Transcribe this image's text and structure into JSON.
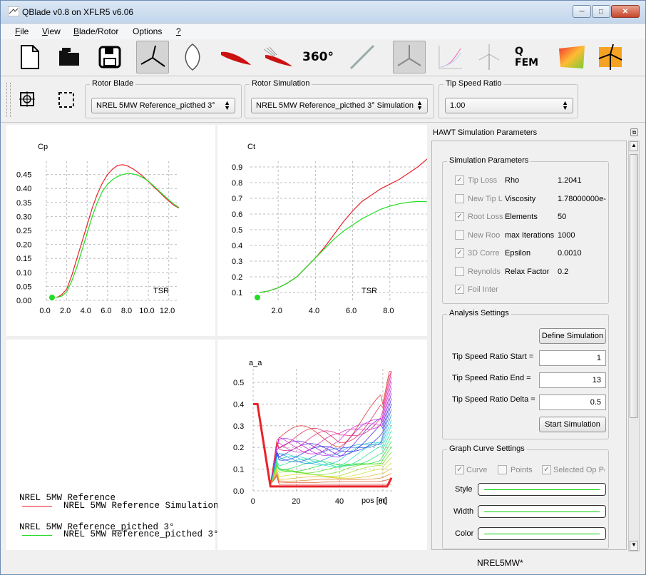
{
  "window": {
    "title": "QBlade v0.8 on XFLR5 v6.06"
  },
  "menu": [
    {
      "label": "File",
      "u": "F",
      "rest": "ile"
    },
    {
      "label": "View",
      "u": "V",
      "rest": "iew"
    },
    {
      "label": "Blade/Rotor",
      "u": "B",
      "rest": "lade/Rotor"
    },
    {
      "label": "Options",
      "u": "",
      "rest": "Options"
    },
    {
      "label": "?",
      "u": "?",
      "rest": ""
    }
  ],
  "toolbar": {
    "btn_360": "360°",
    "btn_qfem": "Q FEM"
  },
  "selectors": {
    "rotor_blade": {
      "label": "Rotor Blade",
      "value": "NREL 5MW Reference_picthed 3°"
    },
    "rotor_simulation": {
      "label": "Rotor Simulation",
      "value": "NREL 5MW Reference_picthed 3° Simulation"
    },
    "tip_speed_ratio": {
      "label": "Tip Speed Ratio",
      "value": "1.00"
    }
  },
  "graphs": {
    "cp": {
      "title": "Cp",
      "xlabel": "TSR",
      "yticks": [
        "0.45",
        "0.40",
        "0.35",
        "0.30",
        "0.25",
        "0.20",
        "0.15",
        "0.10",
        "0.05",
        "0.00"
      ],
      "xticks": [
        "0.0",
        "2.0",
        "4.0",
        "6.0",
        "8.0",
        "10.0",
        "12.0"
      ]
    },
    "ct": {
      "title": "Ct",
      "xlabel": "TSR",
      "yticks": [
        "0.9",
        "0.8",
        "0.7",
        "0.6",
        "0.5",
        "0.4",
        "0.3",
        "0.2",
        "0.1"
      ],
      "xticks": [
        "2.0",
        "4.0",
        "6.0",
        "8.0"
      ]
    },
    "aa": {
      "title": "a_a",
      "xlabel": "pos [m]",
      "yticks": [
        "0.5",
        "0.4",
        "0.3",
        "0.2",
        "0.1",
        "0.0"
      ],
      "xticks": [
        "0",
        "20",
        "40",
        "60"
      ]
    }
  },
  "legend": [
    {
      "label": "NREL 5MW Reference",
      "color": ""
    },
    {
      "label": "NREL 5MW Reference Simulation",
      "color": "#e8232a"
    },
    {
      "label": "NREL 5MW Reference_picthed 3°",
      "color": ""
    },
    {
      "label": "NREL 5MW Reference_picthed 3° Simulation",
      "color": "#22dd22"
    }
  ],
  "chart_data": [
    {
      "type": "line",
      "title": "Cp",
      "xlabel": "TSR",
      "ylim": [
        0,
        0.5
      ],
      "xlim": [
        0,
        13
      ],
      "series": [
        {
          "name": "NREL 5MW Reference Simulation",
          "color": "#e8232a",
          "x": [
            1,
            1.5,
            2,
            2.5,
            3,
            3.5,
            4,
            4.5,
            5,
            5.5,
            6,
            6.5,
            7,
            7.5,
            8,
            8.5,
            9,
            9.5,
            10,
            10.5,
            11,
            11.5,
            12,
            12.5,
            13
          ],
          "y": [
            0.01,
            0.02,
            0.04,
            0.09,
            0.15,
            0.21,
            0.27,
            0.33,
            0.38,
            0.42,
            0.45,
            0.47,
            0.483,
            0.485,
            0.48,
            0.47,
            0.457,
            0.442,
            0.425,
            0.407,
            0.39,
            0.372,
            0.355,
            0.34,
            0.33
          ]
        },
        {
          "name": "NREL 5MW Reference_picthed 3° Simulation",
          "color": "#22dd22",
          "x": [
            1,
            1.5,
            2,
            2.5,
            3,
            3.5,
            4,
            4.5,
            5,
            5.5,
            6,
            6.5,
            7,
            7.5,
            8,
            8.5,
            9,
            9.5,
            10,
            10.5,
            11,
            11.5,
            12,
            12.5,
            13
          ],
          "y": [
            0.01,
            0.015,
            0.03,
            0.07,
            0.12,
            0.18,
            0.24,
            0.3,
            0.35,
            0.39,
            0.415,
            0.432,
            0.443,
            0.45,
            0.454,
            0.452,
            0.447,
            0.438,
            0.426,
            0.41,
            0.393,
            0.376,
            0.36,
            0.344,
            0.332
          ]
        }
      ]
    },
    {
      "type": "line",
      "title": "Ct",
      "xlabel": "TSR",
      "ylim": [
        0.1,
        0.95
      ],
      "xlim": [
        1,
        10
      ],
      "series": [
        {
          "name": "NREL 5MW Reference Simulation",
          "color": "#e8232a",
          "x": [
            1,
            1.5,
            2,
            2.5,
            3,
            3.5,
            4,
            4.5,
            5,
            5.5,
            6,
            6.5,
            7,
            7.5,
            8,
            8.5,
            9,
            9.5,
            10
          ],
          "y": [
            0.1,
            0.11,
            0.13,
            0.16,
            0.2,
            0.26,
            0.32,
            0.39,
            0.47,
            0.55,
            0.62,
            0.68,
            0.72,
            0.76,
            0.79,
            0.82,
            0.86,
            0.9,
            0.95
          ]
        },
        {
          "name": "NREL 5MW Reference_picthed 3° Simulation",
          "color": "#22dd22",
          "x": [
            1,
            1.5,
            2,
            2.5,
            3,
            3.5,
            4,
            4.5,
            5,
            5.5,
            6,
            6.5,
            7,
            7.5,
            8,
            8.5,
            9,
            9.5,
            10
          ],
          "y": [
            0.1,
            0.11,
            0.13,
            0.16,
            0.2,
            0.26,
            0.32,
            0.38,
            0.44,
            0.49,
            0.53,
            0.57,
            0.6,
            0.63,
            0.65,
            0.665,
            0.675,
            0.68,
            0.678
          ]
        }
      ]
    }
  ],
  "rpanel": {
    "title": "HAWT Simulation Parameters",
    "sim_params_label": "Simulation Parameters",
    "checks": [
      {
        "label": "Tip Loss",
        "checked": true
      },
      {
        "label": "New Tip L",
        "checked": false
      },
      {
        "label": "Root Loss",
        "checked": true
      },
      {
        "label": "New Roo",
        "checked": false
      },
      {
        "label": "3D Corre",
        "checked": true
      },
      {
        "label": "Reynolds",
        "checked": false
      },
      {
        "label": "Foil Inter",
        "checked": true
      }
    ],
    "params": [
      {
        "name": "Rho",
        "value": "1.2041"
      },
      {
        "name": "Viscosity",
        "value": "1.78000000e-"
      },
      {
        "name": "Elements",
        "value": "50"
      },
      {
        "name": "max Iterations",
        "value": "1000"
      },
      {
        "name": "Epsilon",
        "value": "0.0010"
      },
      {
        "name": "Relax Factor",
        "value": "0.2"
      }
    ],
    "analysis_label": "Analysis Settings",
    "define_sim": "Define Simulation",
    "tsr_start_label": "Tip Speed Ratio Start =",
    "tsr_start": "1",
    "tsr_end_label": "Tip Speed Ratio End =",
    "tsr_end": "13",
    "tsr_delta_label": "Tip Speed Ratio Delta =",
    "tsr_delta": "0.5",
    "start_sim": "Start Simulation",
    "graph_curve_label": "Graph Curve Settings",
    "curve_label": "Curve",
    "points_label": "Points",
    "selected_label": "Selected Op Po",
    "style_label": "Style",
    "width_label": "Width",
    "color_label": "Color"
  },
  "status": {
    "project": "NREL5MW*"
  }
}
